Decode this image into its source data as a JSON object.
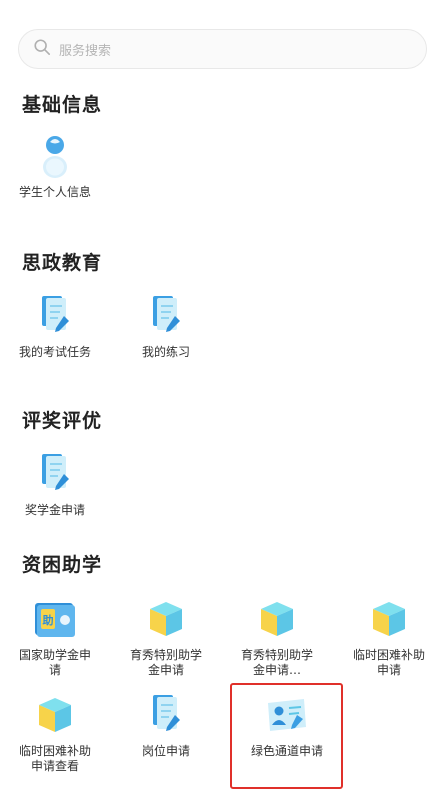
{
  "search": {
    "placeholder": "服务搜索",
    "icon": "search-icon"
  },
  "sections": [
    {
      "title": "基础信息",
      "items": [
        {
          "label": "学生个人信息",
          "icon": "person-icon"
        }
      ]
    },
    {
      "title": "思政教育",
      "items": [
        {
          "label": "我的考试任务",
          "icon": "document-pen-icon"
        },
        {
          "label": "我的练习",
          "icon": "document-pen-icon"
        }
      ]
    },
    {
      "title": "评奖评优",
      "items": [
        {
          "label": "奖学金申请",
          "icon": "document-pen-icon"
        }
      ]
    },
    {
      "title": "资困助学",
      "items": [
        {
          "label": "国家助学金申请",
          "icon": "grant-card-icon"
        },
        {
          "label": "育秀特别助学金申请",
          "icon": "cube-icon"
        },
        {
          "label": "育秀特别助学金申请…",
          "icon": "cube-icon"
        },
        {
          "label": "临时困难补助申请",
          "icon": "cube-icon"
        },
        {
          "label": "临时困难补助申请查看",
          "icon": "cube-icon"
        },
        {
          "label": "岗位申请",
          "icon": "document-pen-icon"
        },
        {
          "label": "绿色通道申请",
          "icon": "id-card-icon"
        }
      ]
    }
  ],
  "colors": {
    "highlight": "#e0302a",
    "icon_blue": "#4aa8e8",
    "icon_yellow": "#f7d34a",
    "icon_cyan": "#7fe0ee"
  }
}
